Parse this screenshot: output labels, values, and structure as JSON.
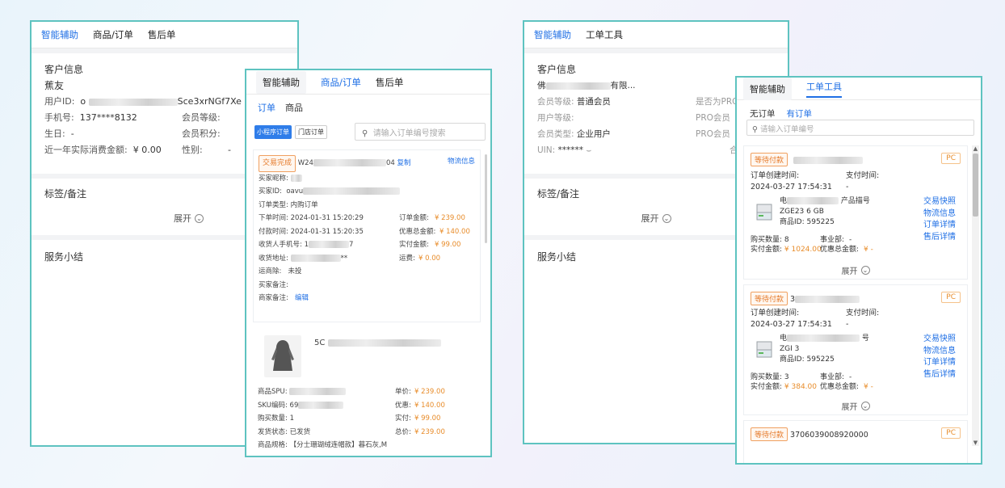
{
  "w1": {
    "tabs": [
      "智能辅助",
      "商品/订单",
      "售后单"
    ],
    "customer": {
      "title": "客户信息",
      "name": "蕉友",
      "uid_label": "用户ID:",
      "uid_value": "o",
      "uid_tail": "Sce3xrNGf7Xe",
      "phone_label": "手机号:",
      "phone": "137****8132",
      "level_label": "会员等级:",
      "birthday_label": "生日:",
      "birthday": "-",
      "points_label": "会员积分:",
      "spend_label": "近一年实际消费金额:",
      "spend": "¥ 0.00",
      "gender_label": "性别:",
      "gender": "-"
    },
    "tags_title": "标签/备注",
    "expand": "展开",
    "service_title": "服务小结"
  },
  "w2": {
    "tabs": [
      "智能辅助",
      "商品/订单",
      "售后单"
    ],
    "subtabs": [
      "订单",
      "商品"
    ],
    "filters": [
      "小程序订单",
      "门店订单"
    ],
    "search_placeholder": "请输入订单编号搜索",
    "order": {
      "status": "交易完成",
      "order_no_head": "W24",
      "order_no_tail": "04",
      "copy": "复制",
      "logistics": "物流信息",
      "buyer_nick_label": "买家昵称:",
      "buyer_id_label": "买家ID:",
      "buyer_id": "oavu",
      "order_type_label": "订单类型:",
      "order_type": "内购订单",
      "created_label": "下单时间:",
      "created": "2024-01-31 15:20:29",
      "amount_label": "订单金额:",
      "amount": "¥ 239.00",
      "paid_label": "付款时间:",
      "paid": "2024-01-31 15:20:35",
      "discount_label": "优惠总金额:",
      "discount": "¥ 140.00",
      "receiver_phone_label": "收货人手机号:",
      "receiver_phone": "1",
      "receiver_phone_tail": "7",
      "actual_label": "实付金额:",
      "actual": "¥ 99.00",
      "address_label": "收货地址:",
      "address_tail": "**",
      "freight_label": "运费:",
      "freight": "¥ 0.00",
      "carrier_label": "运商除:",
      "carrier": "未投",
      "buyer_note_label": "买家备注:",
      "merchant_note_label": "商家备注:",
      "edit": "编辑"
    },
    "product": {
      "title_head": "5C",
      "spu_label": "商品SPU:",
      "sku_label": "SKU编码:",
      "sku_head": "69",
      "qty_label": "购买数量:",
      "qty": "1",
      "ship_label": "发货状态:",
      "ship": "已发货",
      "spec_label": "商品规格:",
      "spec": "【分士珊瑚绒连帽款】暮石灰,M",
      "price_label": "单价:",
      "price": "¥ 239.00",
      "pdiscount_label": "优惠:",
      "pdiscount": "¥ 140.00",
      "pactual_label": "实付:",
      "pactual": "¥ 99.00",
      "total_label": "总价:",
      "total": "¥ 239.00"
    }
  },
  "w3": {
    "tabs": [
      "智能辅助",
      "工单工具"
    ],
    "customer": {
      "title": "客户信息",
      "name_head": "佛",
      "name_tail": "有限...",
      "level_label": "会员等级:",
      "level": "普通会员",
      "pro_label": "是否为PRO",
      "mobile_label": "用户等级:",
      "member_type_label": "会员类型:",
      "member_type": "企业用户",
      "uin_label": "UIN:",
      "uin": "******",
      "pro_member_label": "PRO会员",
      "pro_label2": "PRO会员",
      "he_label": "合"
    },
    "tags_title": "标签/备注",
    "expand": "展开",
    "service_title": "服务小结"
  },
  "w4": {
    "tabs": [
      "智能辅助",
      "工单工具"
    ],
    "subtabs": [
      "无订单",
      "有订单"
    ],
    "search_placeholder": "请输入订单编号",
    "orders": [
      {
        "status": "等待付款",
        "no": "",
        "created_label": "订单创建时间:",
        "pay_label": "支付时间:",
        "created": "2024-03-27 17:54:31",
        "pay": "-",
        "name_head": "电",
        "name_tail": "产品描号",
        "model": "ZGE23   6 GB",
        "product_id_label": "商品ID:",
        "product_id": "595225",
        "qty_label": "购买数量:",
        "qty": "8",
        "dept_label": "事业部:",
        "dept": "-",
        "actual_label": "实付金额:",
        "actual": "¥ 1024.00",
        "disc_label": "优惠总金额:",
        "disc": "¥ -"
      },
      {
        "status": "等待付款",
        "no": "3",
        "created_label": "订单创建时间:",
        "pay_label": "支付时间:",
        "created": "2024-03-27 17:54:31",
        "pay": "-",
        "name_head": "电",
        "name_tail": "号",
        "model": "ZGI   3",
        "product_id_label": "商品ID:",
        "product_id": "595225",
        "qty_label": "购买数量:",
        "qty": "3",
        "dept_label": "事业部:",
        "dept": "-",
        "actual_label": "实付金额:",
        "actual": "¥ 384.00",
        "disc_label": "优惠总金额:",
        "disc": "¥ -"
      },
      {
        "status": "等待付款",
        "no": "3706039008920000"
      }
    ],
    "platform": "PC",
    "links": [
      "交易快照",
      "物流信息",
      "订单详情",
      "售后详情"
    ],
    "expand": "展开"
  }
}
